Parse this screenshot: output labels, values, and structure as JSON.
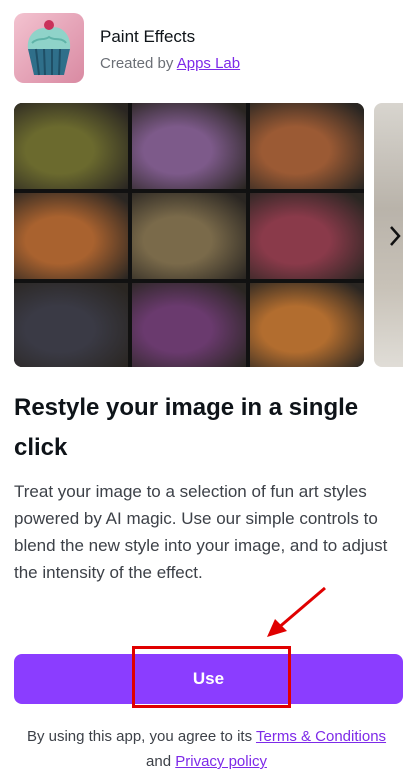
{
  "app": {
    "name": "Paint Effects",
    "credit_prefix": "Created by",
    "credit_link": "Apps Lab",
    "icon": "cupcake-icon"
  },
  "gallery": {
    "tile_colors": [
      "#6b6a2e",
      "#7d5a8a",
      "#9b5a34",
      "#a9622f",
      "#7a6a4a",
      "#8a3a4a",
      "#3a3a45",
      "#6a3a6e",
      "#b26d2f"
    ],
    "next_icon": "chevron-right-icon"
  },
  "content": {
    "headline": "Restyle your image in a single click",
    "description": "Treat your image to a selection of fun art styles powered by AI magic. Use our simple controls to blend the new style into your image, and to adjust the intensity of the effect."
  },
  "actions": {
    "use_label": "Use"
  },
  "terms": {
    "prefix": "By using this app, you agree to its",
    "terms_link": "Terms & Conditions",
    "joiner": "and",
    "privacy_link": "Privacy policy"
  },
  "colors": {
    "accent": "#8b3dff",
    "link": "#7d2ae8",
    "annotation": "#e00000"
  }
}
